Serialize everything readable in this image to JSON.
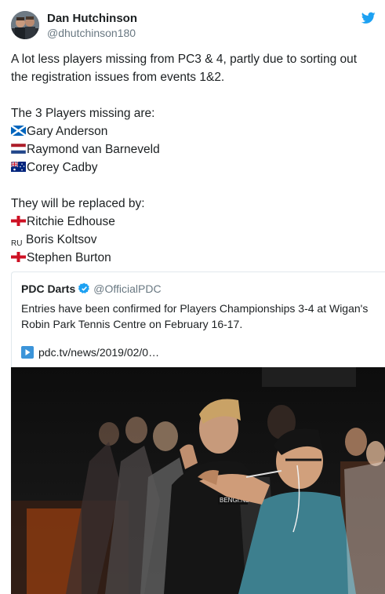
{
  "author": {
    "display_name": "Dan Hutchinson",
    "handle": "@dhutchinson180"
  },
  "tweet": {
    "lines": [
      "A lot less players missing from PC3 & 4, partly due to sorting out",
      "the registration issues from events 1&2.",
      "The 3 Players missing are:",
      "Gary Anderson",
      "Raymond van Barneveld",
      "Corey Cadby",
      "They will be replaced by:",
      "Ritchie Edhouse",
      "RU",
      "Boris Koltsov",
      "Stephen Burton"
    ],
    "flags": {
      "gary_anderson": "scotland-flag-icon",
      "raymond_van_barneveld": "netherlands-flag-icon",
      "corey_cadby": "australia-flag-icon",
      "ritchie_edhouse": "england-flag-icon",
      "stephen_burton": "england-flag-icon"
    }
  },
  "quoted_tweet": {
    "name": "PDC Darts",
    "handle": "@OfficialPDC",
    "text": "Entries have been confirmed for Players Championships 3-4 at Wigan's Robin Park Tennis Centre on February 16-17.",
    "link_text": "pdc.tv/news/2019/02/0…",
    "link_icon": "play-link-icon",
    "verified_icon": "verified-badge-icon"
  },
  "media": {
    "shirt_text": "BENGI.NL"
  },
  "colors": {
    "twitter_blue": "#1da1f2",
    "text": "#1c2022",
    "secondary_text": "#697882",
    "border": "#e1e8ed"
  }
}
